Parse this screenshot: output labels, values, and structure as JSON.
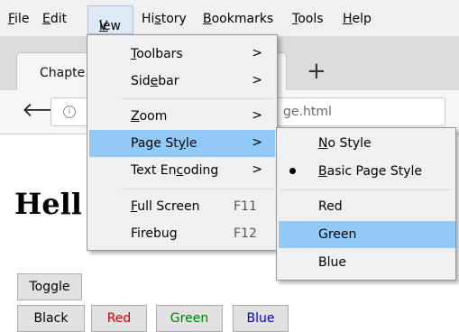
{
  "menubar": {
    "file": {
      "pre": "",
      "mn": "F",
      "post": "ile"
    },
    "edit": {
      "pre": "",
      "mn": "E",
      "post": "dit"
    },
    "view": {
      "pre": "",
      "mn": "V",
      "post": "iew"
    },
    "history": {
      "pre": "Hi",
      "mn": "s",
      "post": "tory"
    },
    "bookmarks": {
      "pre": "",
      "mn": "B",
      "post": "ookmarks"
    },
    "tools": {
      "pre": "",
      "mn": "T",
      "post": "ools"
    },
    "help": {
      "pre": "",
      "mn": "H",
      "post": "elp"
    }
  },
  "tab": {
    "title": "Chapte",
    "new_tab_glyph": "+"
  },
  "navbar": {
    "back_glyph": "🡐",
    "info_glyph": "i",
    "url_fragment": "ge.html"
  },
  "page": {
    "heading": "Hell",
    "buttons": {
      "toggle": "Toggle",
      "black": "Black",
      "red": "Red",
      "green": "Green",
      "blue": "Blue"
    },
    "button_colors": {
      "black": "#000000",
      "red": "#d00000",
      "green": "#008000",
      "blue": "#0000c0"
    }
  },
  "view_menu": {
    "toolbars": {
      "pre": "",
      "mn": "T",
      "post": "oolbars",
      "arrow": ">"
    },
    "sidebar": {
      "pre": "Sid",
      "mn": "e",
      "post": "bar",
      "arrow": ">"
    },
    "zoom": {
      "pre": "",
      "mn": "Z",
      "post": "oom",
      "arrow": ">"
    },
    "page_style": {
      "pre": "Page St",
      "mn": "y",
      "post": "le",
      "arrow": ">"
    },
    "text_encoding": {
      "pre": "Text En",
      "mn": "c",
      "post": "oding",
      "arrow": ">"
    },
    "full_screen": {
      "pre": "",
      "mn": "F",
      "post": "ull Screen",
      "shortcut": "F11"
    },
    "firebug": {
      "label": "Firebug",
      "shortcut": "F12"
    }
  },
  "page_style_menu": {
    "no_style": {
      "pre": "",
      "mn": "N",
      "post": "o Style"
    },
    "basic_page_style": {
      "pre": "",
      "mn": "B",
      "post": "asic Page Style"
    },
    "red": "Red",
    "green": "Green",
    "blue": "Blue"
  },
  "colors": {
    "menu_highlight": "#91c9f7",
    "menu_background": "#f0f0f0",
    "menubar_active": "#dde9f6"
  }
}
